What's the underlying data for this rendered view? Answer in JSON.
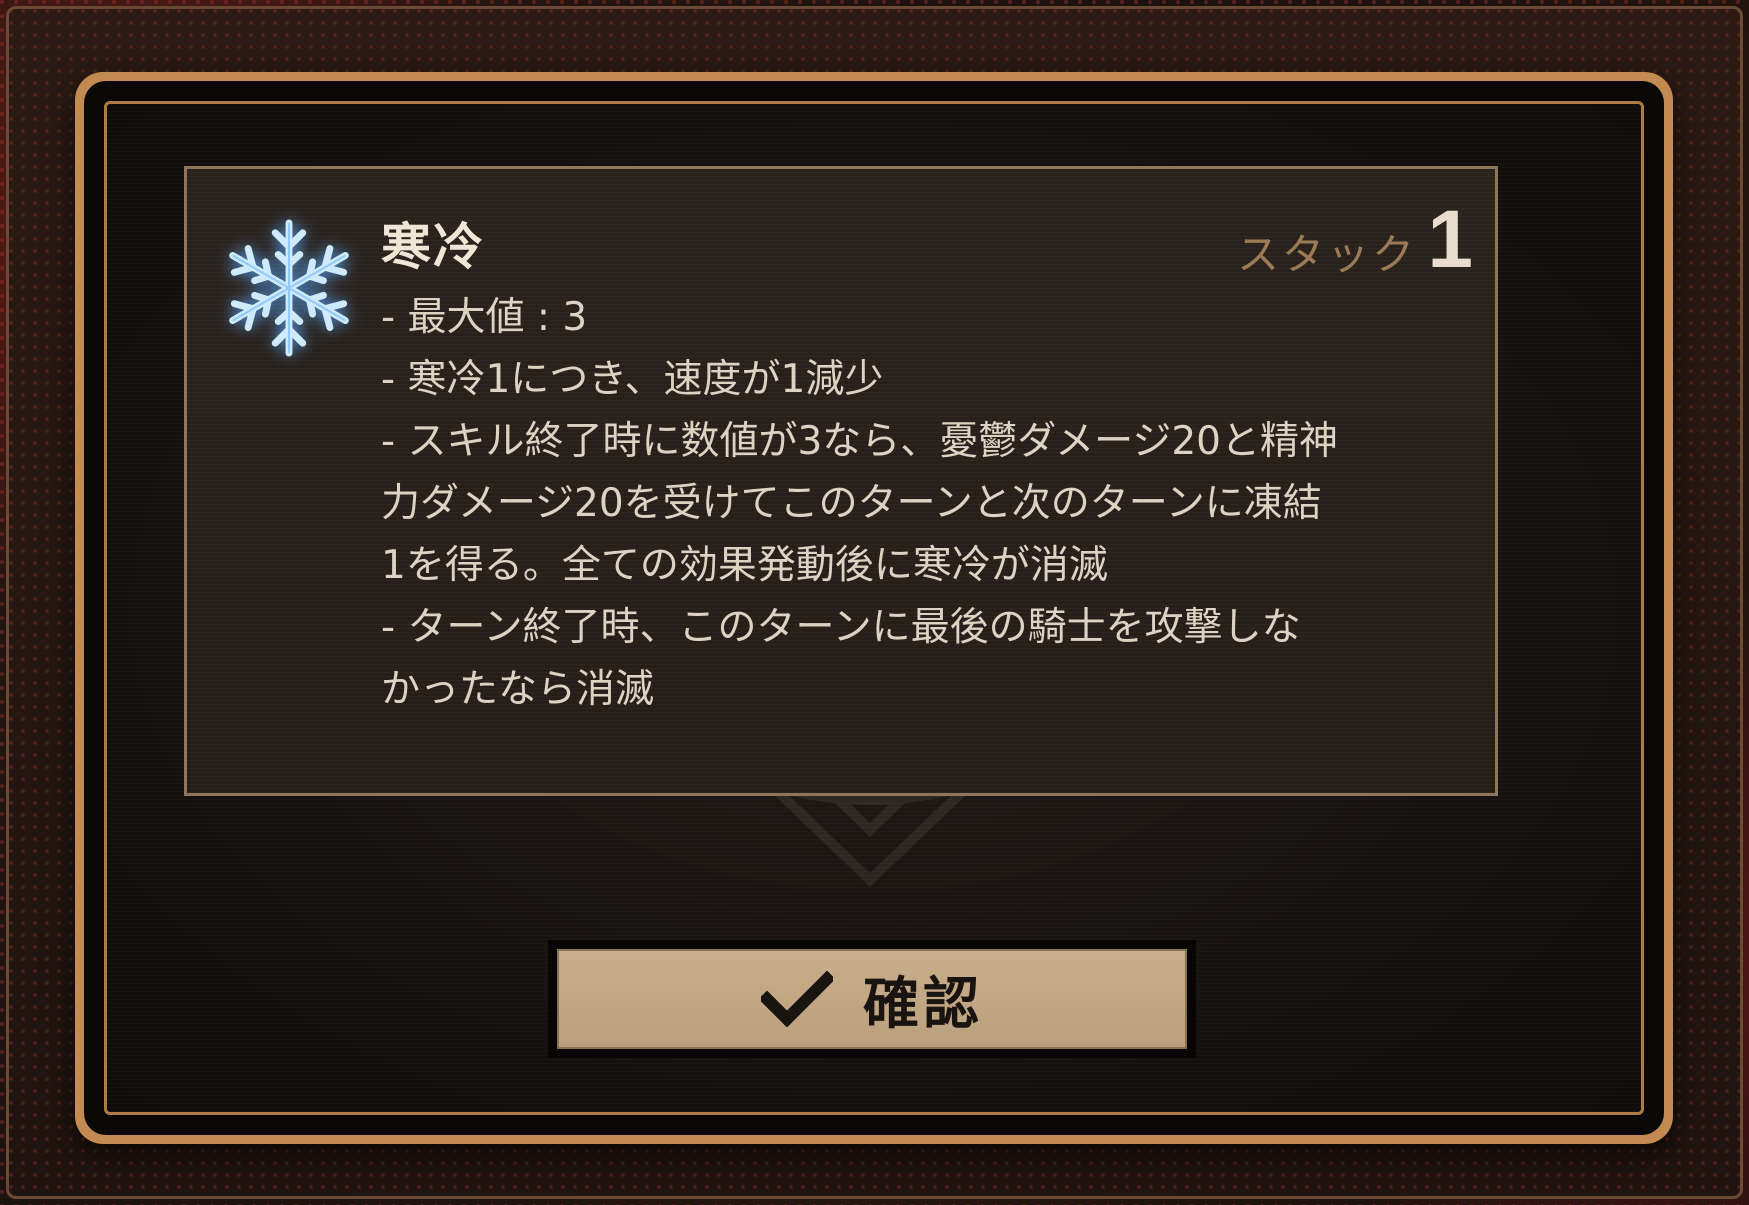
{
  "buff": {
    "icon": "snowflake-icon",
    "title": "寒冷",
    "stack_label": "スタック",
    "stack_value": "1",
    "description": [
      "- 最大値 : 3",
      "- 寒冷1につき、速度が1減少",
      "- スキル終了時に数値が3なら、憂鬱ダメージ20と精神",
      "力ダメージ20を受けてこのターンと次のターンに凍結",
      "1を得る。全ての効果発動後に寒冷が消滅",
      "- ターン終了時、このターンに最後の騎士を攻撃しな",
      "かったなら消滅"
    ]
  },
  "confirm": {
    "icon": "check-icon",
    "label": "確認"
  },
  "colors": {
    "frame_accent": "#c38a52",
    "button_fill": "#c9ae8c",
    "stack_label": "#9c7a55",
    "icon_glow": "#5aaaff"
  }
}
